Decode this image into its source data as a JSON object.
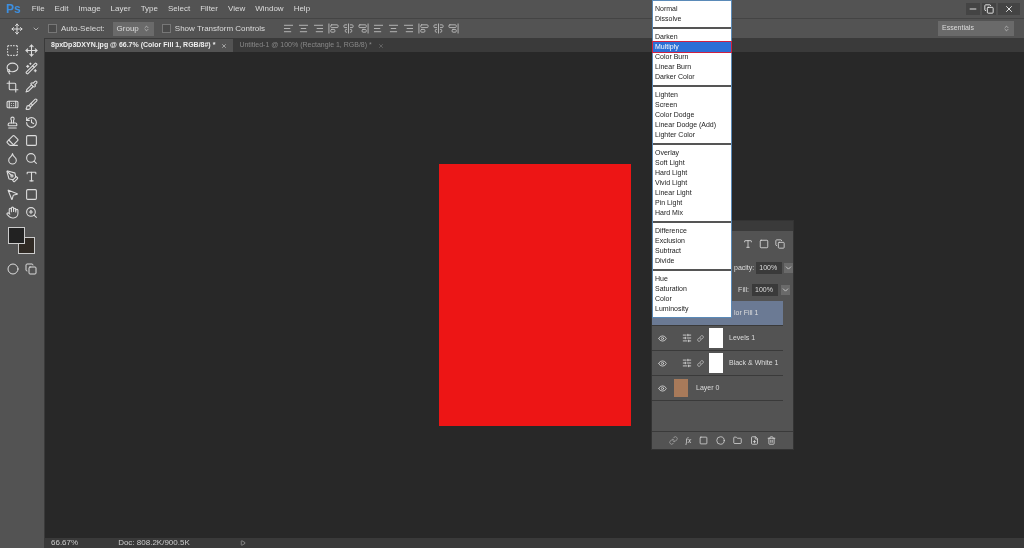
{
  "menu_bar": {
    "logo": "Ps",
    "items": [
      "File",
      "Edit",
      "Image",
      "Layer",
      "Type",
      "Select",
      "Filter",
      "View",
      "Window",
      "Help"
    ]
  },
  "options_bar": {
    "auto_select": {
      "label": "Auto-Select:",
      "checked": false
    },
    "group_select": "Group",
    "transform_controls": {
      "label": "Show Transform Controls",
      "checked": false
    },
    "workspace": "Essentials"
  },
  "tabs": [
    {
      "label": "8pxDp3DXYN.jpg @ 66.7% (Color Fill 1, RGB/8#) *",
      "selected": true
    },
    {
      "label": "Untitled-1 @ 100% (Rectangle 1, RGB/8) *",
      "selected": false
    }
  ],
  "blend_modes": [
    [
      {
        "label": "Normal",
        "selected": false
      },
      {
        "label": "Dissolve",
        "selected": false
      }
    ],
    [
      {
        "label": "Darken",
        "selected": false
      },
      {
        "label": "Multiply",
        "selected": true
      },
      {
        "label": "Color Burn",
        "selected": false
      },
      {
        "label": "Linear Burn",
        "selected": false
      },
      {
        "label": "Darker Color",
        "selected": false
      }
    ],
    [
      {
        "label": "Lighten",
        "selected": false
      },
      {
        "label": "Screen",
        "selected": false
      },
      {
        "label": "Color Dodge",
        "selected": false
      },
      {
        "label": "Linear Dodge (Add)",
        "selected": false
      },
      {
        "label": "Lighter Color",
        "selected": false
      }
    ],
    [
      {
        "label": "Overlay",
        "selected": false
      },
      {
        "label": "Soft Light",
        "selected": false
      },
      {
        "label": "Hard Light",
        "selected": false
      },
      {
        "label": "Vivid Light",
        "selected": false
      },
      {
        "label": "Linear Light",
        "selected": false
      },
      {
        "label": "Pin Light",
        "selected": false
      },
      {
        "label": "Hard Mix",
        "selected": false
      }
    ],
    [
      {
        "label": "Difference",
        "selected": false
      },
      {
        "label": "Exclusion",
        "selected": false
      },
      {
        "label": "Subtract",
        "selected": false
      },
      {
        "label": "Divide",
        "selected": false
      }
    ],
    [
      {
        "label": "Hue",
        "selected": false
      },
      {
        "label": "Saturation",
        "selected": false
      },
      {
        "label": "Color",
        "selected": false
      },
      {
        "label": "Luminosity",
        "selected": false
      }
    ]
  ],
  "layers_panel": {
    "fx_label": "fx",
    "opacity_label": "pacity:",
    "opacity": "100%",
    "fill_label": "Fill:",
    "fill": "100%",
    "layers": [
      {
        "name": "lor Fill 1",
        "kind": "fill",
        "selected": true
      },
      {
        "name": "Levels 1",
        "kind": "adjustment",
        "visible": true,
        "selected": false
      },
      {
        "name": "Black & White 1",
        "kind": "adjustment",
        "visible": true,
        "selected": false
      },
      {
        "name": "Layer 0",
        "kind": "image",
        "visible": true,
        "selected": false
      }
    ]
  },
  "status_bar": {
    "zoom": "66.67%",
    "doc": "Doc: 808.2K/900.5K"
  }
}
